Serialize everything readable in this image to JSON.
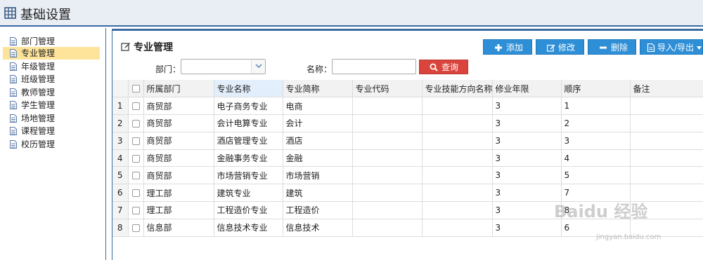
{
  "app": {
    "title": "基础设置"
  },
  "sidebar": {
    "items": [
      {
        "label": "部门管理",
        "active": false
      },
      {
        "label": "专业管理",
        "active": true
      },
      {
        "label": "年级管理",
        "active": false
      },
      {
        "label": "班级管理",
        "active": false
      },
      {
        "label": "教师管理",
        "active": false
      },
      {
        "label": "学生管理",
        "active": false
      },
      {
        "label": "场地管理",
        "active": false
      },
      {
        "label": "课程管理",
        "active": false
      },
      {
        "label": "校历管理",
        "active": false
      }
    ]
  },
  "panel": {
    "title": "专业管理"
  },
  "toolbar": {
    "add_label": "添加",
    "edit_label": "修改",
    "delete_label": "删除",
    "import_export_label": "导入/导出"
  },
  "filters": {
    "dept_label": "部门：",
    "dept_value": "",
    "name_label": "名称：",
    "name_value": "",
    "search_label": "查询"
  },
  "table": {
    "columns": [
      "所属部门",
      "专业名称",
      "专业简称",
      "专业代码",
      "专业技能方向名称",
      "修业年限",
      "顺序",
      "备注"
    ],
    "rows": [
      {
        "num": "1",
        "dept": "商贸部",
        "name": "电子商务专业",
        "short": "电商",
        "code": "",
        "skill": "",
        "years": "3",
        "order": "1",
        "note": ""
      },
      {
        "num": "2",
        "dept": "商贸部",
        "name": "会计电算专业",
        "short": "会计",
        "code": "",
        "skill": "",
        "years": "3",
        "order": "2",
        "note": ""
      },
      {
        "num": "3",
        "dept": "商贸部",
        "name": "酒店管理专业",
        "short": "酒店",
        "code": "",
        "skill": "",
        "years": "3",
        "order": "3",
        "note": ""
      },
      {
        "num": "4",
        "dept": "商贸部",
        "name": "金融事务专业",
        "short": "金融",
        "code": "",
        "skill": "",
        "years": "3",
        "order": "4",
        "note": ""
      },
      {
        "num": "5",
        "dept": "商贸部",
        "name": "市场营销专业",
        "short": "市场营销",
        "code": "",
        "skill": "",
        "years": "3",
        "order": "5",
        "note": ""
      },
      {
        "num": "6",
        "dept": "理工部",
        "name": "建筑专业",
        "short": "建筑",
        "code": "",
        "skill": "",
        "years": "3",
        "order": "7",
        "note": ""
      },
      {
        "num": "7",
        "dept": "理工部",
        "name": "工程造价专业",
        "short": "工程造价",
        "code": "",
        "skill": "",
        "years": "3",
        "order": "8",
        "note": ""
      },
      {
        "num": "8",
        "dept": "信息部",
        "name": "信息技术专业",
        "short": "信息技术",
        "code": "",
        "skill": "",
        "years": "3",
        "order": "6",
        "note": ""
      }
    ]
  },
  "watermark": {
    "text": "Baidu 经验",
    "url": "jingyan.baidu.com"
  },
  "colors": {
    "accent": "#3b6aa3",
    "primary_button": "#2f8fd6",
    "search_button": "#d9443c",
    "active_item": "#fde49a"
  }
}
